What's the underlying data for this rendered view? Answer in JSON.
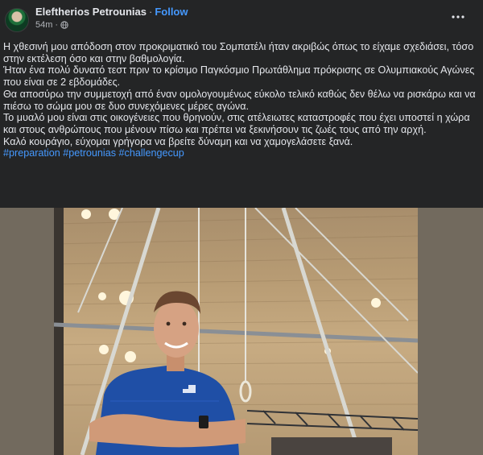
{
  "post": {
    "author": "Eleftherios Petrounias",
    "separator": "·",
    "follow_label": "Follow",
    "time": "54m",
    "dot": "·",
    "paragraphs": [
      "Η χθεσινή μου απόδοση στον προκριματικό του Σομπατέλι ήταν ακριβώς όπως το είχαμε σχεδιάσει, τόσο στην εκτέλεση όσο και στην βαθμολογία.",
      "Ήταν ένα πολύ δυνατό τεστ πριν το κρίσιμο Παγκόσμιο Πρωτάθλημα πρόκρισης σε Ολυμπιακούς Αγώνες που είναι σε 2 εβδομάδες.",
      "Θα αποσύρω την συμμετοχή από έναν ομολογουμένως εύκολο τελικό καθώς δεν θέλω να ρισκάρω και να πιέσω το σώμα μου σε δυο συνεχόμενες μέρες αγώνα.",
      "Το μυαλό μου είναι στις οικογένειες που θρηνούν, στις ατέλειωτες καταστροφές που έχει υποστεί η χώρα και στους ανθρώπους που μένουν πίσω και πρέπει να ξεκινήσουν τις ζωές τους από την αρχή.",
      "Καλό κουράγιο, εύχομαι γρήγορα να βρείτε δύναμη και να χαμογελάσετε ξανά."
    ],
    "hashtags": [
      "#preparation",
      "#petrounias",
      "#challengecup"
    ]
  },
  "icons": {
    "globe": "globe-icon",
    "more": "more-options-icon",
    "avatar": "profile-avatar"
  },
  "colors": {
    "background": "#242526",
    "text": "#e4e6eb",
    "secondary_text": "#b0b3b8",
    "link": "#4599ff",
    "jersey": "#1f4fa6"
  }
}
